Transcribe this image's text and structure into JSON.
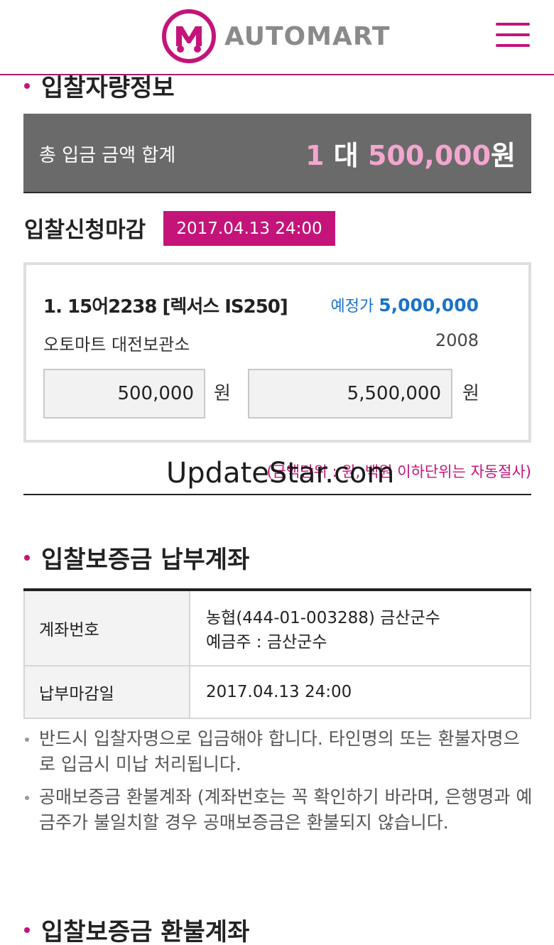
{
  "header": {
    "brand": "AUTOMART",
    "menu_icon": "hamburger-menu-icon",
    "accent_color": "#c4147a"
  },
  "section1": {
    "title": "입찰자량정보"
  },
  "total": {
    "label": "총 입금 금액 합계",
    "count": "1",
    "unit": "대",
    "amount": "500,000",
    "currency": "원"
  },
  "deadline": {
    "label": "입찰신청마감",
    "value": "2017.04.13 24:00"
  },
  "car": {
    "title": "1. 15어2238 [렉서스 IS250]",
    "est_label": "예정가",
    "est_value": "5,000,000",
    "location": "오토마트 대전보관소",
    "year": "2008",
    "deposit": "500,000",
    "bid": "5,500,000",
    "won": "원"
  },
  "note": "(금액단위 : 원, 백원 이하단위는 자동절사)",
  "watermark": "UpdateStar.com",
  "section2": {
    "title": "입찰보증금 납부계좌"
  },
  "account_table": {
    "account_label": "계좌번호",
    "account_line1": "농협(444-01-003288) 금산군수",
    "account_line2": "예금주 : 금산군수",
    "due_label": "납부마감일",
    "due_value": "2017.04.13 24:00"
  },
  "bullets": [
    "반드시 입찰자명으로 입금해야 합니다. 타인명의 또는 환불자명으로 입금시 미납 처리됩니다.",
    "공매보증금 환불계좌 (계좌번호는 꼭 확인하기 바라며, 은행명과 예금주가 불일치할 경우 공매보증금은 환불되지 않습니다."
  ],
  "section3": {
    "title": "입찰보증금 환불계좌"
  }
}
